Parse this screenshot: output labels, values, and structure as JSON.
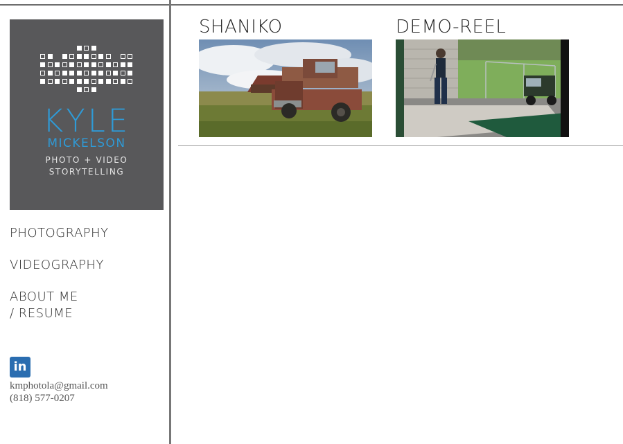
{
  "logo": {
    "name": "KYLE",
    "surname": "MICKELSON",
    "tagline1": "PHOTO + VIDEO",
    "tagline2": "STORYTELLING"
  },
  "nav": {
    "photography": "PHOTOGRAPHY",
    "videography": "VIDEOGRAPHY",
    "about": "ABOUT ME / RESUME"
  },
  "contact": {
    "linkedin_icon_text": "in",
    "email": "kmphotola@gmail.com",
    "phone": "(818) 577-0207"
  },
  "projects": [
    {
      "title": "SHANIKO"
    },
    {
      "title": "DEMO-REEL"
    }
  ],
  "colors": {
    "logo_bg": "#58585a",
    "accent": "#2f9ad6",
    "linkedin": "#2a6db0"
  }
}
